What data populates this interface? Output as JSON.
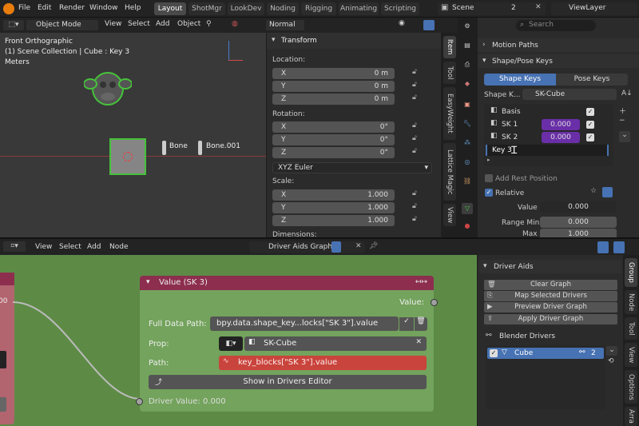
{
  "topbar": {
    "menus": [
      "File",
      "Edit",
      "Render",
      "Window",
      "Help"
    ],
    "workspaces": [
      "Layout",
      "ShotMgr",
      "LookDev",
      "Noding",
      "Rigging",
      "Animating",
      "Scripting"
    ],
    "scene_label": "Scene",
    "scene_users": "2",
    "view_layer": "ViewLayer"
  },
  "viewport": {
    "mode": "Object Mode",
    "menus": [
      "View",
      "Select",
      "Add",
      "Object"
    ],
    "shading": "Normal",
    "overlay_title": "Front Orthographic",
    "overlay_collection": "(1) Scene Collection | Cube : Key 3",
    "overlay_units": "Meters",
    "bone_labels": [
      "Bone",
      "Bone.001"
    ]
  },
  "transform": {
    "title": "Transform",
    "location_label": "Location:",
    "location": [
      {
        "axis": "X",
        "value": "0 m"
      },
      {
        "axis": "Y",
        "value": "0 m"
      },
      {
        "axis": "Z",
        "value": "0 m"
      }
    ],
    "rotation_label": "Rotation:",
    "rotation": [
      {
        "axis": "X",
        "value": "0°"
      },
      {
        "axis": "Y",
        "value": "0°"
      },
      {
        "axis": "Z",
        "value": "0°"
      }
    ],
    "rotation_mode": "XYZ Euler",
    "scale_label": "Scale:",
    "scale": [
      {
        "axis": "X",
        "value": "1.000"
      },
      {
        "axis": "Y",
        "value": "1.000"
      },
      {
        "axis": "Z",
        "value": "1.000"
      }
    ],
    "dimensions_label": "Dimensions:"
  },
  "sidebar_tabs": [
    "Item",
    "Tool",
    "EasyWeight",
    "Lattice Magic",
    "View"
  ],
  "properties": {
    "search_placeholder": "Search",
    "motion_paths": "Motion Paths",
    "shape_pose_keys": "Shape/Pose Keys",
    "tab_shape": "Shape Keys",
    "tab_pose": "Pose Keys",
    "shape_key_label": "Shape K...",
    "shape_key_name": "SK-Cube",
    "keys": [
      {
        "name": "Basis",
        "value": ""
      },
      {
        "name": "SK 1",
        "value": "0.000"
      },
      {
        "name": "SK 2",
        "value": "0.000"
      }
    ],
    "editing_key": "Key 3",
    "add_rest_position": "Add Rest Position",
    "relative": "Relative",
    "value_label": "Value",
    "value": "0.000",
    "range_min_label": "Range Min",
    "range_min": "0.000",
    "max_label": "Max",
    "max": "1.000"
  },
  "node_editor": {
    "menus": [
      "View",
      "Select",
      "Add",
      "Node"
    ],
    "tree_name": "Driver Aids Graph",
    "node_title": "Value (SK 3)",
    "output_label": "Value:",
    "full_path_label": "Full Data Path:",
    "full_path_value": "bpy.data.shape_key...locks[\"SK 3\"].value",
    "prop_label": "Prop:",
    "prop_value": "SK-Cube",
    "path_label": "Path:",
    "path_value": "key_blocks[\"SK 3\"].value",
    "show_button": "Show in Drivers Editor",
    "driver_value": "Driver Value: 0.000",
    "left_node_value": "00"
  },
  "driver_aids": {
    "title": "Driver Aids",
    "buttons": [
      "Clear Graph",
      "Map Selected Drivers",
      "Preview Driver Graph",
      "Apply Driver Graph"
    ],
    "blender_drivers": "Blender Drivers",
    "driver_item": "Cube",
    "driver_count": "2"
  },
  "node_tabs": [
    "Group",
    "Node",
    "Tool",
    "View",
    "Options",
    "Arra"
  ],
  "colors": {
    "accent": "#4772b3",
    "node_header": "#8d2e4f",
    "path_red": "#c9443c",
    "editor_bg": "#5d8b46",
    "purple_value": "#6a2fa8"
  }
}
